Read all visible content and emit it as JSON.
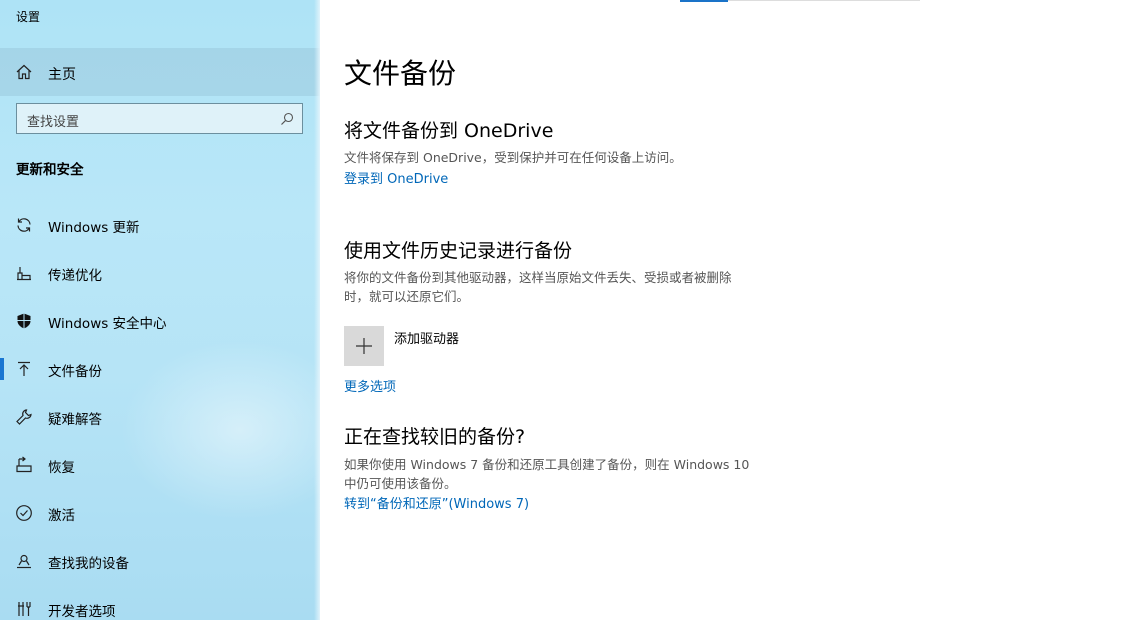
{
  "window": {
    "title": "设置"
  },
  "sidebar": {
    "home": {
      "label": "主页",
      "icon": "home-icon"
    },
    "search": {
      "placeholder": "查找设置",
      "icon": "search-icon"
    },
    "section_title": "更新和安全",
    "items": [
      {
        "label": "Windows 更新",
        "icon": "refresh-icon"
      },
      {
        "label": "传递优化",
        "icon": "delivery-optimization-icon"
      },
      {
        "label": "Windows 安全中心",
        "icon": "shield-icon"
      },
      {
        "label": "文件备份",
        "icon": "backup-arrow-icon",
        "active": true
      },
      {
        "label": "疑难解答",
        "icon": "wrench-icon"
      },
      {
        "label": "恢复",
        "icon": "recovery-icon"
      },
      {
        "label": "激活",
        "icon": "check-circle-icon"
      },
      {
        "label": "查找我的设备",
        "icon": "find-device-icon"
      },
      {
        "label": "开发者选项",
        "icon": "developer-tools-icon"
      }
    ]
  },
  "main": {
    "title": "文件备份",
    "onedrive": {
      "heading": "将文件备份到 OneDrive",
      "description": "文件将保存到 OneDrive，受到保护并可在任何设备上访问。",
      "link": "登录到 OneDrive"
    },
    "file_history": {
      "heading": "使用文件历史记录进行备份",
      "description_line1": "将你的文件备份到其他驱动器，这样当原始文件丢失、受损或者被删除",
      "description_line2": "时，就可以还原它们。",
      "add_drive_label": "添加驱动器",
      "more_options_link": "更多选项"
    },
    "older_backup": {
      "heading": "正在查找较旧的备份?",
      "description_line1": "如果你使用 Windows 7 备份和还原工具创建了备份，则在 Windows 10",
      "description_line2": "中仍可使用该备份。",
      "link": "转到“备份和还原”(Windows 7)"
    }
  },
  "colors": {
    "accent": "#0067b8",
    "active_indicator": "#1976d2",
    "sidebar_bg": "#b6e4f6"
  }
}
